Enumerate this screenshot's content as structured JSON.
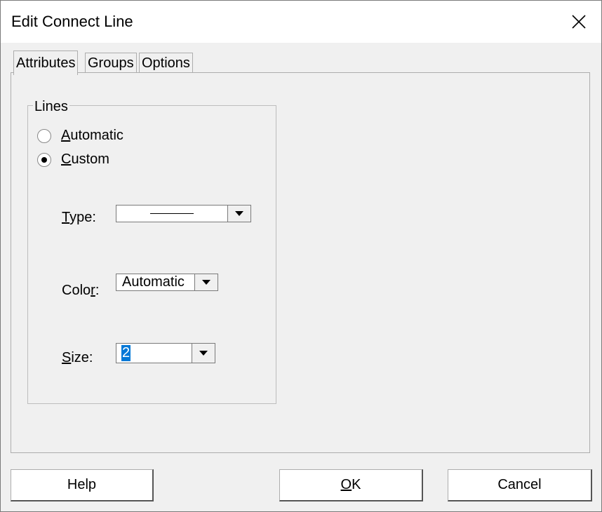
{
  "window": {
    "title": "Edit Connect Line"
  },
  "tabs": [
    {
      "label": "Attributes",
      "active": true
    },
    {
      "label": "Groups",
      "active": false
    },
    {
      "label": "Options",
      "active": false
    }
  ],
  "lines_group": {
    "legend": "Lines",
    "radios": [
      {
        "label_first": "A",
        "label_rest": "utomatic",
        "checked": false
      },
      {
        "label_first": "C",
        "label_rest": "ustom",
        "checked": true
      }
    ],
    "type": {
      "label_first": "T",
      "label_rest": "ype:"
    },
    "color": {
      "label_pre": "Colo",
      "label_u": "r",
      "label_post": ":",
      "value": "Automatic"
    },
    "size": {
      "label_first": "S",
      "label_rest": "ize:",
      "value": "2"
    }
  },
  "buttons": {
    "help": "Help",
    "ok_first": "O",
    "ok_rest": "K",
    "cancel": "Cancel"
  },
  "icons": {
    "close": "close-icon",
    "dropdown": "chevron-down-icon"
  }
}
